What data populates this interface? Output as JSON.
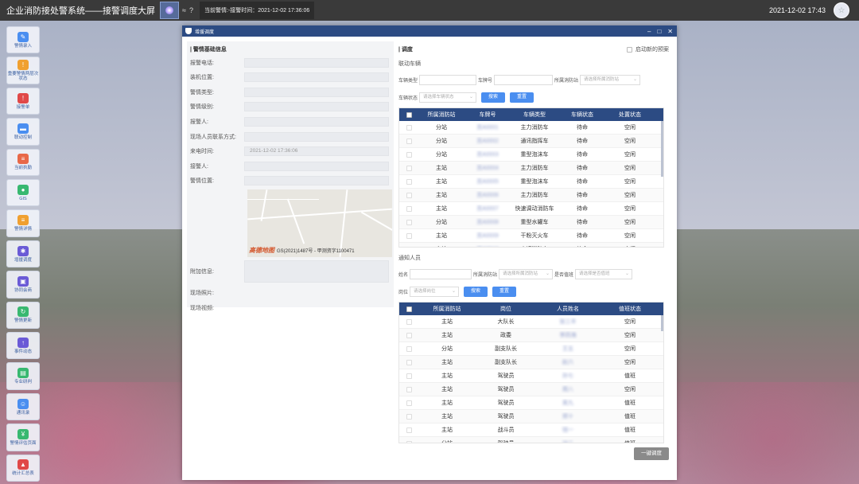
{
  "topbar": {
    "title": "企业消防接处警系统——接警调度大屏",
    "icon_glyph": "≈",
    "help_glyph": "?",
    "alarm_text": "当前警情:-接警时间：2021-12-02 17:36:06",
    "datetime": "2021-12-02 17:43"
  },
  "sidebar": {
    "items": [
      {
        "label": "警情录入",
        "icon": "pencil-icon",
        "color": "#4a8ef0"
      },
      {
        "label": "重要警情两层次状态",
        "icon": "bell-icon",
        "color": "#f0a030"
      },
      {
        "label": "接警单",
        "icon": "alert-icon",
        "color": "#e04848"
      },
      {
        "label": "联动控制",
        "icon": "truck-icon",
        "color": "#4a8ef0"
      },
      {
        "label": "当前执勤",
        "icon": "doc-icon",
        "color": "#e86848"
      },
      {
        "label": "GIS",
        "icon": "map-pin-icon",
        "color": "#38b870"
      },
      {
        "label": "警情详情",
        "icon": "list-icon",
        "color": "#f0a030"
      },
      {
        "label": "增援调度",
        "icon": "gear-icon",
        "color": "#6a5ad6"
      },
      {
        "label": "协同会商",
        "icon": "screen-icon",
        "color": "#6a5ad6"
      },
      {
        "label": "警情更新",
        "icon": "refresh-icon",
        "color": "#38b870"
      },
      {
        "label": "事件动态",
        "icon": "upload-icon",
        "color": "#6a5ad6"
      },
      {
        "label": "专业研判",
        "icon": "book-icon",
        "color": "#38b870"
      },
      {
        "label": "通讯录",
        "icon": "contacts-icon",
        "color": "#4a8ef0"
      },
      {
        "label": "警情评估页面",
        "icon": "money-icon",
        "color": "#38b870"
      },
      {
        "label": "统计汇总表",
        "icon": "chart-icon",
        "color": "#e04848"
      }
    ]
  },
  "modal": {
    "title": "增援调度",
    "left": {
      "heading": "| 警情基础信息",
      "fields": [
        {
          "label": "报警电话:",
          "value": ""
        },
        {
          "label": "装机位置:",
          "value": ""
        },
        {
          "label": "警情类型:",
          "value": ""
        },
        {
          "label": "警情级别:",
          "value": ""
        },
        {
          "label": "报警人:",
          "value": ""
        },
        {
          "label": "现场人员联系方式:",
          "value": ""
        },
        {
          "label": "来电时间:",
          "value": "2021-12-02 17:36:06"
        },
        {
          "label": "接警人:",
          "value": ""
        },
        {
          "label": "警情位置:",
          "value": ""
        }
      ],
      "map_logo": "高德地图",
      "map_caption": "GS(2021)1487号 - 甲测资字1100471",
      "extra_label": "附加信息:",
      "photo_label": "现场照片:",
      "video_label": "现场视频:"
    },
    "right": {
      "heading": "| 调度",
      "auto_plan": "启动新的预案",
      "vehicles": {
        "heading": "联动车辆",
        "filters": {
          "type_label": "车辆类型",
          "plate_label": "车牌号",
          "station_label": "所属消防站",
          "station_placeholder": "请选择所属消防站",
          "status_label": "车辆状态",
          "status_placeholder": "请选择车辆状态",
          "search": "搜索",
          "reset": "重置"
        },
        "columns": [
          "所属消防站",
          "车牌号",
          "车辆类型",
          "车辆状态",
          "处置状态"
        ],
        "rows": [
          [
            "分站",
            "苏A0001",
            "主力消防车",
            "待命",
            "空闲"
          ],
          [
            "分站",
            "苏A0002",
            "通讯指挥车",
            "待命",
            "空闲"
          ],
          [
            "分站",
            "苏A0003",
            "重型泡沫车",
            "待命",
            "空闲"
          ],
          [
            "主站",
            "苏A0004",
            "主力消防车",
            "待命",
            "空闲"
          ],
          [
            "主站",
            "苏A0005",
            "重型泡沫车",
            "待命",
            "空闲"
          ],
          [
            "主站",
            "苏A0006",
            "主力消防车",
            "待命",
            "空闲"
          ],
          [
            "主站",
            "苏A0007",
            "快速调动消防车",
            "待命",
            "空闲"
          ],
          [
            "分站",
            "苏A0008",
            "重型水罐车",
            "待命",
            "空闲"
          ],
          [
            "主站",
            "苏A0009",
            "干粉灭火车",
            "待命",
            "空闲"
          ],
          [
            "主站",
            "苏A0010",
            "水罐消防车",
            "待命",
            "空闲"
          ]
        ]
      },
      "staff": {
        "heading": "通知人员",
        "filters": {
          "name_label": "姓名",
          "station_label": "所属消防站",
          "station_placeholder": "请选择所属消防站",
          "duty_label": "是否值班",
          "duty_placeholder": "请选择是否值班",
          "post_label": "岗位",
          "post_placeholder": "请选择岗位",
          "search": "搜索",
          "reset": "重置"
        },
        "columns": [
          "所属消防站",
          "岗位",
          "人员姓名",
          "值班状态"
        ],
        "rows": [
          [
            "主站",
            "大队长",
            "张三丰",
            "空闲"
          ],
          [
            "主站",
            "政委",
            "李四海",
            "空闲"
          ],
          [
            "分站",
            "副支队长",
            "王五",
            "空闲"
          ],
          [
            "主站",
            "副支队长",
            "赵六",
            "空闲"
          ],
          [
            "主站",
            "驾驶员",
            "孙七",
            "值班"
          ],
          [
            "主站",
            "驾驶员",
            "周八",
            "空闲"
          ],
          [
            "主站",
            "驾驶员",
            "吴九",
            "值班"
          ],
          [
            "主站",
            "驾驶员",
            "郑十",
            "值班"
          ],
          [
            "主站",
            "战斗员",
            "钱一",
            "值班"
          ],
          [
            "分站",
            "驾驶员",
            "冯二",
            "值班"
          ]
        ]
      },
      "dispatch_button": "一键调度"
    }
  }
}
